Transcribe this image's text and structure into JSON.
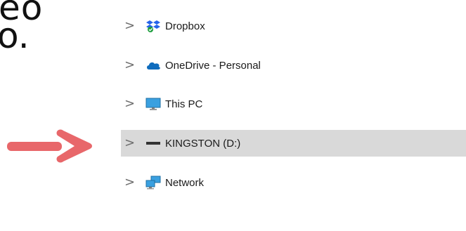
{
  "background_text": {
    "line1": "eo",
    "line2": "o."
  },
  "nav_tree": {
    "items": [
      {
        "label": "Dropbox",
        "icon": "dropbox-icon"
      },
      {
        "label": "OneDrive - Personal",
        "icon": "onedrive-cloud-icon"
      },
      {
        "label": "This PC",
        "icon": "monitor-icon"
      },
      {
        "label": "KINGSTON (D:)",
        "icon": "usb-drive-icon",
        "selected": true
      },
      {
        "label": "Network",
        "icon": "network-icon"
      }
    ],
    "expand_glyph": ">"
  },
  "colors": {
    "selected_row": "#d9d9d9",
    "arrow": "#e8676a",
    "onedrive": "#0f6cbd",
    "dropbox": "#2563eb"
  }
}
